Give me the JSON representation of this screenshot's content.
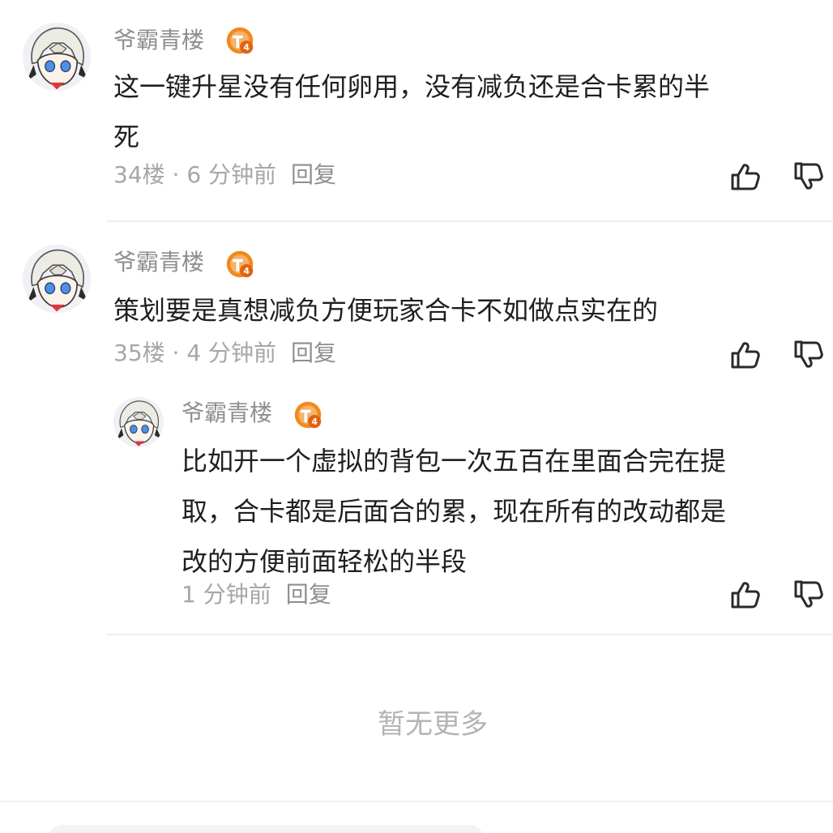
{
  "comments": [
    {
      "username": "爷霸青楼",
      "badge_label": "T4",
      "text_lines": [
        "这一键升星没有任何卵用，没有减负还是合卡累的半",
        "死"
      ],
      "floor_time": "34楼 · 6 分钟前",
      "reply_label": "回复"
    },
    {
      "username": "爷霸青楼",
      "badge_label": "T4",
      "text_lines": [
        "策划要是真想减负方便玩家合卡不如做点实在的"
      ],
      "floor_time": "35楼 · 4 分钟前",
      "reply_label": "回复",
      "replies": [
        {
          "username": "爷霸青楼",
          "badge_label": "T4",
          "text_lines": [
            "比如开一个虚拟的背包一次五百在里面合完在提",
            "取，合卡都是后面合的累，现在所有的改动都是",
            "改的方便前面轻松的半段"
          ],
          "time": "1 分钟前",
          "reply_label": "回复"
        }
      ]
    }
  ],
  "footer": {
    "no_more_text": "暂无更多"
  },
  "colors": {
    "badge_orange": "#f08a1c",
    "text_primary": "#1f1f1f",
    "text_secondary": "#8e8e93"
  },
  "icons": {
    "like": "thumbs-up-icon",
    "dislike": "thumbs-down-icon"
  }
}
